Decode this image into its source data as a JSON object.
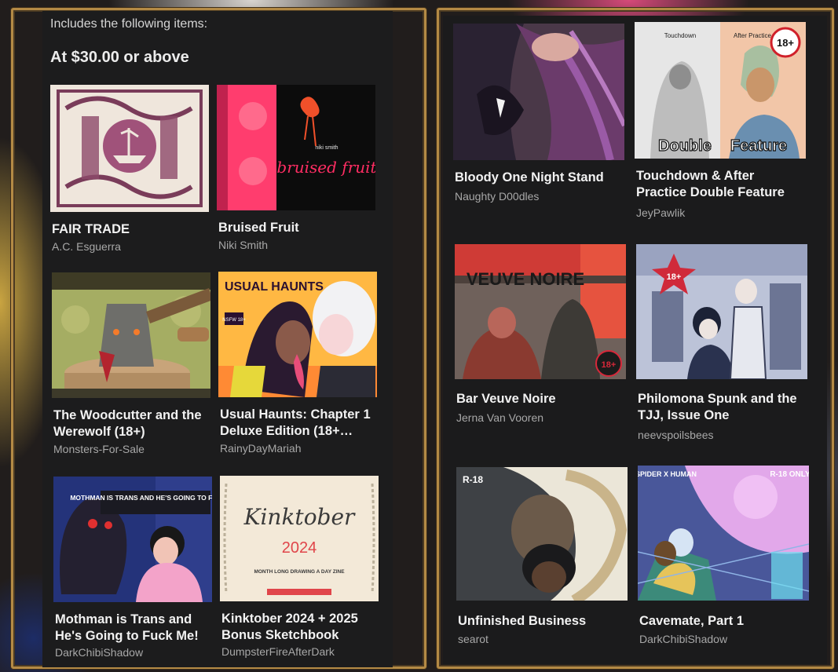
{
  "left_panel": {
    "header": "Includes the following items:",
    "tier": "At $30.00 or above",
    "items": [
      {
        "title": "FAIR TRADE",
        "author": "A.C. Esguerra"
      },
      {
        "title": "Bruised Fruit",
        "author": "Niki Smith",
        "cover_text_top": "niki smith",
        "cover_text": "bruised fruit"
      },
      {
        "title": "The Woodcutter and the\nWerewolf (18+)",
        "author": "Monsters-For-Sale"
      },
      {
        "title": "Usual Haunts: Chapter 1\nDeluxe Edition (18+…",
        "author": "RainyDayMariah",
        "cover_text": "USUAL HAUNTS",
        "cover_badge": "NSFW 18+"
      },
      {
        "title": "Mothman is Trans and\nHe's Going to Fuck Me!",
        "author": "DarkChibiShadow",
        "cover_text": "MOTHMAN IS TRANS AND HE'S GOING TO FUCK ME!"
      },
      {
        "title": "Kinktober 2024 + 2025\nBonus Sketchbook",
        "author": "DumpsterFireAfterDark",
        "cover_text": "Kinktober",
        "cover_year": "2024",
        "cover_sub": "MONTH LONG DRAWING A DAY ZINE"
      }
    ]
  },
  "right_panel": {
    "items": [
      {
        "title": "Bloody One Night Stand",
        "author": "Naughty D00dles"
      },
      {
        "title": "Touchdown & After\nPractice Double Feature",
        "author": "JeyPawlik",
        "cover_badge": "18+",
        "cover_text_a": "Double",
        "cover_text_b": "Feature",
        "cover_label_a": "Touchdown",
        "cover_label_b": "After Practice"
      },
      {
        "title": "Bar Veuve Noire",
        "author": "Jerna Van Vooren",
        "cover_text": "VEUVE NOIRE",
        "cover_badge": "18+"
      },
      {
        "title": "Philomona Spunk and the\nTJJ, Issue One",
        "author": "neevspoilsbees",
        "cover_badge": "18+"
      },
      {
        "title": "Unfinished Business",
        "author": "searot",
        "cover_badge": "R-18"
      },
      {
        "title": "Cavemate, Part 1",
        "author": "DarkChibiShadow",
        "cover_label": "SPIDER X HUMAN",
        "cover_badge": "R-18 ONLY"
      }
    ]
  }
}
